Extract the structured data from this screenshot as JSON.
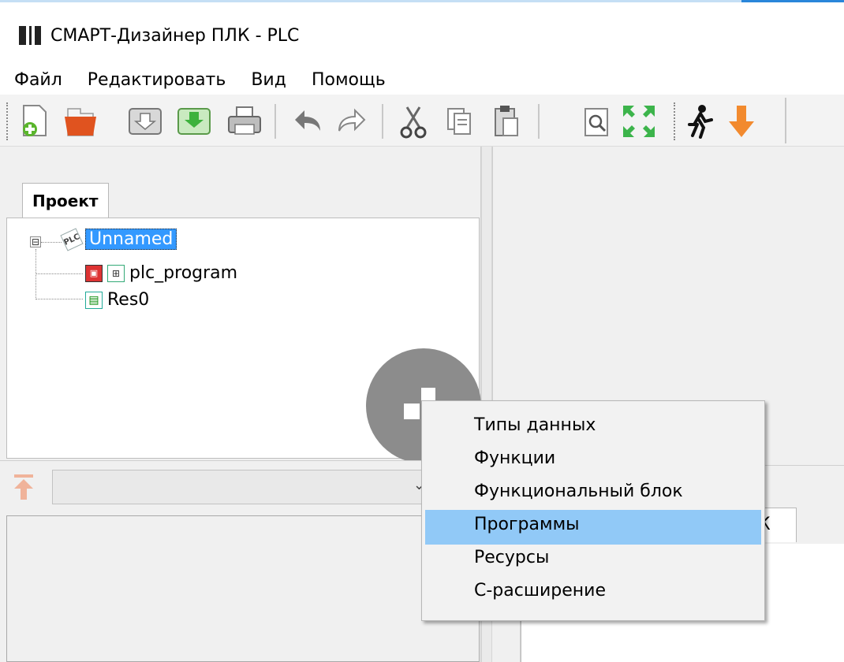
{
  "window": {
    "title": "СМАРТ-Дизайнер ПЛК - PLC",
    "icon": "app-logo-icon"
  },
  "menubar": {
    "items": [
      "Файл",
      "Редактировать",
      "Вид",
      "Помощь"
    ]
  },
  "toolbar": {
    "buttons": [
      {
        "name": "new-file",
        "icon": "new-file-icon"
      },
      {
        "name": "open-folder",
        "icon": "folder-icon"
      },
      {
        "name": "save",
        "icon": "save-icon"
      },
      {
        "name": "save-as",
        "icon": "save-as-icon"
      },
      {
        "name": "print",
        "icon": "print-icon"
      },
      {
        "name": "undo",
        "icon": "undo-icon"
      },
      {
        "name": "redo",
        "icon": "redo-icon"
      },
      {
        "name": "cut",
        "icon": "cut-icon"
      },
      {
        "name": "copy",
        "icon": "copy-icon"
      },
      {
        "name": "paste",
        "icon": "paste-icon"
      },
      {
        "name": "find",
        "icon": "search-icon"
      },
      {
        "name": "fullscreen",
        "icon": "fullscreen-icon"
      },
      {
        "name": "run",
        "icon": "run-icon"
      },
      {
        "name": "download",
        "icon": "download-arrow-icon"
      }
    ]
  },
  "project_panel": {
    "tab_label": "Проект",
    "tree": {
      "root": {
        "label": "Unnamed",
        "icon": "plc-icon",
        "expander": "⊟"
      },
      "children": [
        {
          "label": "plc_program",
          "icons": [
            "program-icon",
            "fbd-icon"
          ]
        },
        {
          "label": "Res0",
          "icon": "resource-icon"
        }
      ]
    }
  },
  "right_panel": {
    "tab_label_partial": "К"
  },
  "context_menu": {
    "items": [
      {
        "label": "Типы данных",
        "highlighted": false
      },
      {
        "label": "Функции",
        "highlighted": false
      },
      {
        "label": "Функциональный блок",
        "highlighted": false
      },
      {
        "label": "Программы",
        "highlighted": true
      },
      {
        "label": "Ресурсы",
        "highlighted": false
      },
      {
        "label": "С-расширение",
        "highlighted": false
      }
    ]
  },
  "colors": {
    "selection": "#3399ff",
    "menu_highlight": "#91c9f7",
    "accent_line": "#2a86da"
  }
}
